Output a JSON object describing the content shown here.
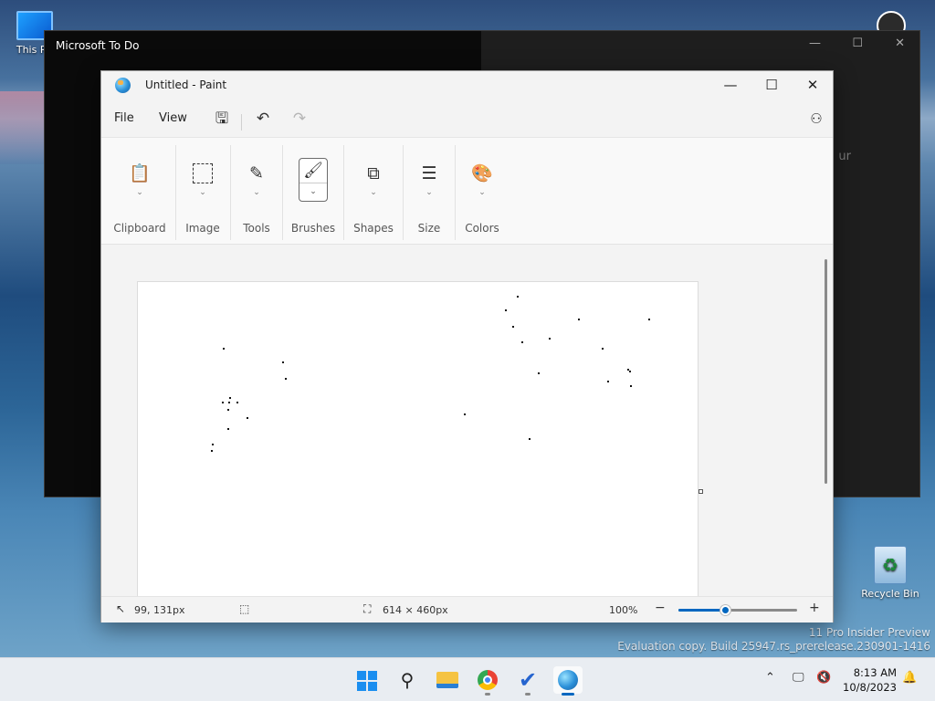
{
  "desktop": {
    "icons": [
      {
        "label": "This PC",
        "icon": "monitor-icon"
      },
      {
        "label": "Recycle Bin",
        "icon": "recycle-bin-icon"
      }
    ],
    "watermark": {
      "line1": "11 Pro Insider Preview",
      "line2": "Evaluation copy. Build 25947.rs_prerelease.230901-1416"
    }
  },
  "todo_window": {
    "title": "Microsoft To Do",
    "ghost_text": "ur"
  },
  "paint": {
    "title": "Untitled - Paint",
    "menu": {
      "file": "File",
      "view": "View"
    },
    "ribbon": {
      "groups": [
        {
          "label": "Clipboard",
          "icon": "clipboard-icon"
        },
        {
          "label": "Image",
          "icon": "selection-icon"
        },
        {
          "label": "Tools",
          "icon": "tools-icon"
        },
        {
          "label": "Brushes",
          "icon": "brush-icon"
        },
        {
          "label": "Shapes",
          "icon": "shapes-icon"
        },
        {
          "label": "Size",
          "icon": "size-icon"
        },
        {
          "label": "Colors",
          "icon": "palette-icon"
        }
      ]
    },
    "status": {
      "cursor_position": "99, 131px",
      "canvas_size": "614 × 460px",
      "zoom": "100%",
      "zoom_level_fraction": 0.4
    }
  },
  "taskbar": {
    "apps": [
      "start-icon",
      "search-icon",
      "file-explorer-icon",
      "chrome-icon",
      "todo-icon",
      "paint-icon"
    ],
    "time": "8:13 AM",
    "date": "10/8/2023"
  },
  "colors": {
    "accent": "#0067c0",
    "todo_bg": "#0a0a0a",
    "canvas": "#ffffff"
  }
}
